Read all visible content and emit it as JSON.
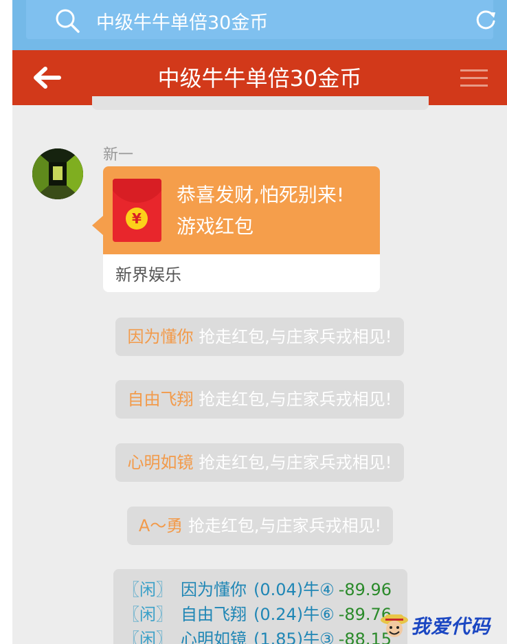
{
  "search": {
    "query": "中级牛牛单倍30金币"
  },
  "header": {
    "title": "中级牛牛单倍30金币"
  },
  "message": {
    "sender": "新一",
    "packet_line1": "恭喜发财,怕死别来!",
    "packet_line2": "游戏红包",
    "packet_source": "新界娱乐",
    "coin_symbol": "¥"
  },
  "notices": [
    {
      "name": "因为懂你",
      "text": " 抢走红包,与庄家兵戎相见!"
    },
    {
      "name": "自由飞翔",
      "text": " 抢走红包,与庄家兵戎相见!"
    },
    {
      "name": "心明如镜",
      "text": " 抢走红包,与庄家兵戎相见!"
    },
    {
      "name": "A～勇",
      "text": " 抢走红包,与庄家兵戎相见!"
    }
  ],
  "results": [
    {
      "tag": "〖闲〗",
      "name": "因为懂你",
      "score": "(0.04)牛④",
      "delta": "-89.96"
    },
    {
      "tag": "〖闲〗",
      "name": "自由飞翔",
      "score": "(0.24)牛⑥",
      "delta": "-89.76"
    },
    {
      "tag": "〖闲〗",
      "name": "心明如镜",
      "score": "(1.85)牛③",
      "delta": "-88.15"
    }
  ],
  "watermark": {
    "text": "我爱代码"
  },
  "colors": {
    "header": "#d2391a",
    "search": "#74b9e8",
    "packet": "#f59e4b",
    "name_accent": "#f29a4a"
  }
}
